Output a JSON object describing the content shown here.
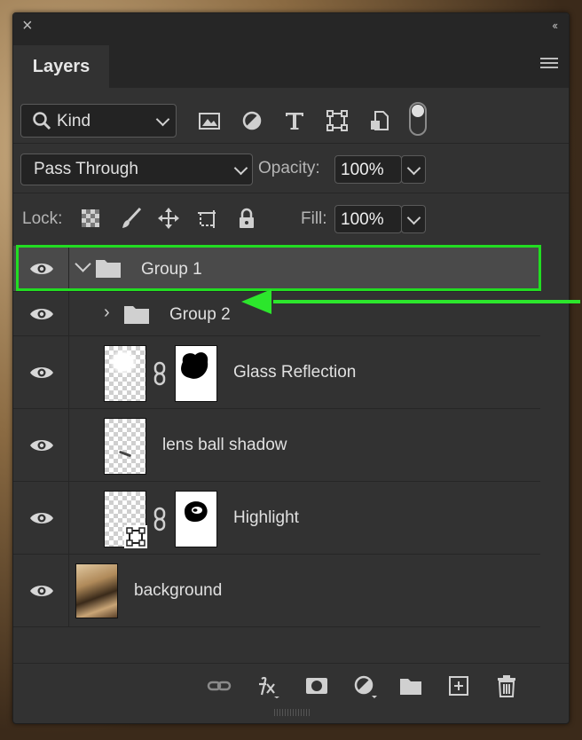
{
  "panel": {
    "tab_label": "Layers",
    "filter": {
      "selected": "Kind"
    },
    "blend_mode": "Pass Through",
    "opacity_label": "Opacity:",
    "opacity_value": "100%",
    "lock_label": "Lock:",
    "fill_label": "Fill:",
    "fill_value": "100%"
  },
  "layers": [
    {
      "name": "Group 1",
      "kind": "group",
      "expanded": true,
      "selected": true,
      "visible": true
    },
    {
      "name": "Group 2",
      "kind": "group",
      "expanded": false,
      "visible": true
    },
    {
      "name": "Glass Reflection",
      "kind": "pixel-with-mask",
      "visible": true
    },
    {
      "name": "lens ball shadow",
      "kind": "pixel",
      "visible": true
    },
    {
      "name": "Highlight",
      "kind": "smart-object-with-mask",
      "visible": true
    },
    {
      "name": "background",
      "kind": "image",
      "visible": true
    }
  ],
  "colors": {
    "panel_bg": "#323232",
    "selected_row": "#4a4a4a",
    "annotation_green": "#2ce62c"
  }
}
